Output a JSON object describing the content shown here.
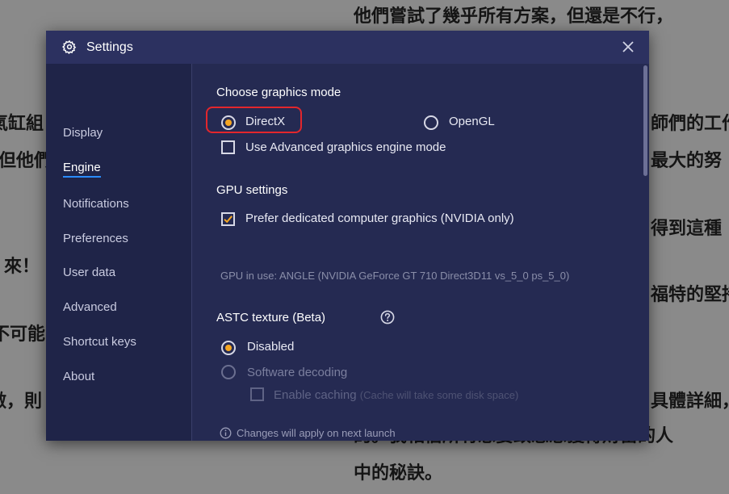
{
  "background": {
    "lines": [
      "他們嘗試了幾乎所有方案，但還是不行，",
      "氣缸組",
      "師們的工作",
      "但他們",
      "最大的努",
      "得到這種",
      "來！",
      "福特的堅持",
      "不可能",
      "做，則",
      "具體詳細，",
      "的。我相信所有想要致志想獲得財富的人",
      "中的秘訣。"
    ]
  },
  "window": {
    "title": "Settings",
    "gear_icon": "gear-icon",
    "close_icon": "close-icon"
  },
  "sidebar": {
    "items": [
      {
        "label": "Display"
      },
      {
        "label": "Engine",
        "active": true
      },
      {
        "label": "Notifications"
      },
      {
        "label": "Preferences"
      },
      {
        "label": "User data"
      },
      {
        "label": "Advanced"
      },
      {
        "label": "Shortcut keys"
      },
      {
        "label": "About"
      }
    ]
  },
  "graphics": {
    "title": "Choose graphics mode",
    "options": [
      {
        "label": "DirectX",
        "selected": true
      },
      {
        "label": "OpenGL",
        "selected": false
      }
    ],
    "advanced_label": "Use Advanced graphics engine mode",
    "advanced_checked": false
  },
  "gpu": {
    "title": "GPU settings",
    "dedicated_label": "Prefer dedicated computer graphics (NVIDIA only)",
    "dedicated_checked": true,
    "in_use": "GPU in use: ANGLE (NVIDIA GeForce GT 710 Direct3D11 vs_5_0 ps_5_0)"
  },
  "astc": {
    "title": "ASTC texture (Beta)",
    "help_icon": "help-circle-icon",
    "options": [
      {
        "label": "Disabled",
        "selected": true
      },
      {
        "label": "Software decoding",
        "selected": false
      }
    ],
    "caching_label": "Enable caching",
    "caching_note": "(Cache will take some disk space)"
  },
  "footer": {
    "note": "Changes will apply on next launch",
    "icon": "info-circle-icon"
  },
  "colors": {
    "accent": "#f5a623",
    "highlight": "#e3262c",
    "active_underline": "#2b8cff"
  }
}
